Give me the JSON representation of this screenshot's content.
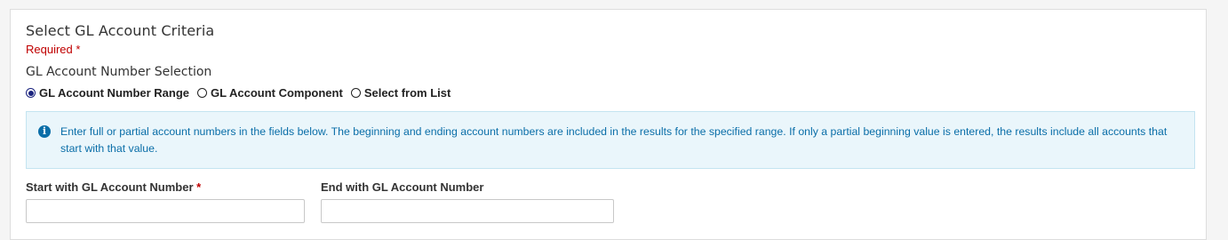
{
  "section": {
    "title": "Select GL Account Criteria",
    "required_label": "Required",
    "required_star": "*"
  },
  "selection": {
    "label": "GL Account Number Selection",
    "options": [
      {
        "label": "GL Account Number Range",
        "checked": true
      },
      {
        "label": "GL Account Component",
        "checked": false
      },
      {
        "label": "Select from List",
        "checked": false
      }
    ]
  },
  "info": {
    "icon": "info-icon",
    "icon_glyph": "i",
    "text": "Enter full or partial account numbers in the fields below. The beginning and ending account numbers are included in the results for the specified range. If only a partial beginning value is entered, the results include all accounts that start with that value."
  },
  "fields": {
    "start": {
      "label": "Start with GL Account Number",
      "required_star": "*",
      "value": ""
    },
    "end": {
      "label": "End with GL Account Number",
      "value": ""
    }
  },
  "colors": {
    "accent": "#1a237e",
    "info_text": "#0a6ea8",
    "info_bg": "#eaf6fb",
    "required": "#c00000"
  }
}
